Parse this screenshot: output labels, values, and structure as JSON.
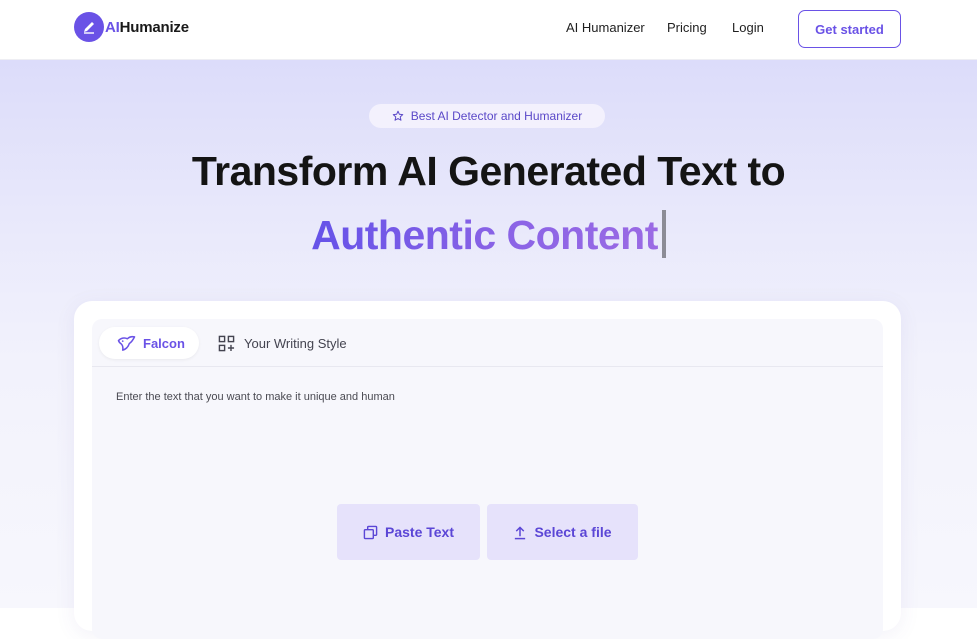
{
  "nav": {
    "logo_ai": "AI",
    "logo_rest": "Humanize",
    "links": [
      "AI Humanizer",
      "Pricing",
      "Login"
    ],
    "cta_label": "Get started"
  },
  "hero": {
    "badge": "Best AI Detector and Humanizer",
    "title_line1": "Transform AI Generated Text to",
    "title_line2": "Authentic Content"
  },
  "editor": {
    "tabs": [
      {
        "label": "Falcon",
        "icon": "bird-icon",
        "active": true
      },
      {
        "label": "Your Writing Style",
        "icon": "grid-plus-icon",
        "active": false
      }
    ],
    "placeholder": "Enter the text that you want to make it unique and human",
    "paste_label": "Paste Text",
    "file_label": "Select a file"
  },
  "colors": {
    "accent": "#6a52e6",
    "button_bg": "#e6e2fb",
    "hero_bg": "#e8e8fb"
  }
}
